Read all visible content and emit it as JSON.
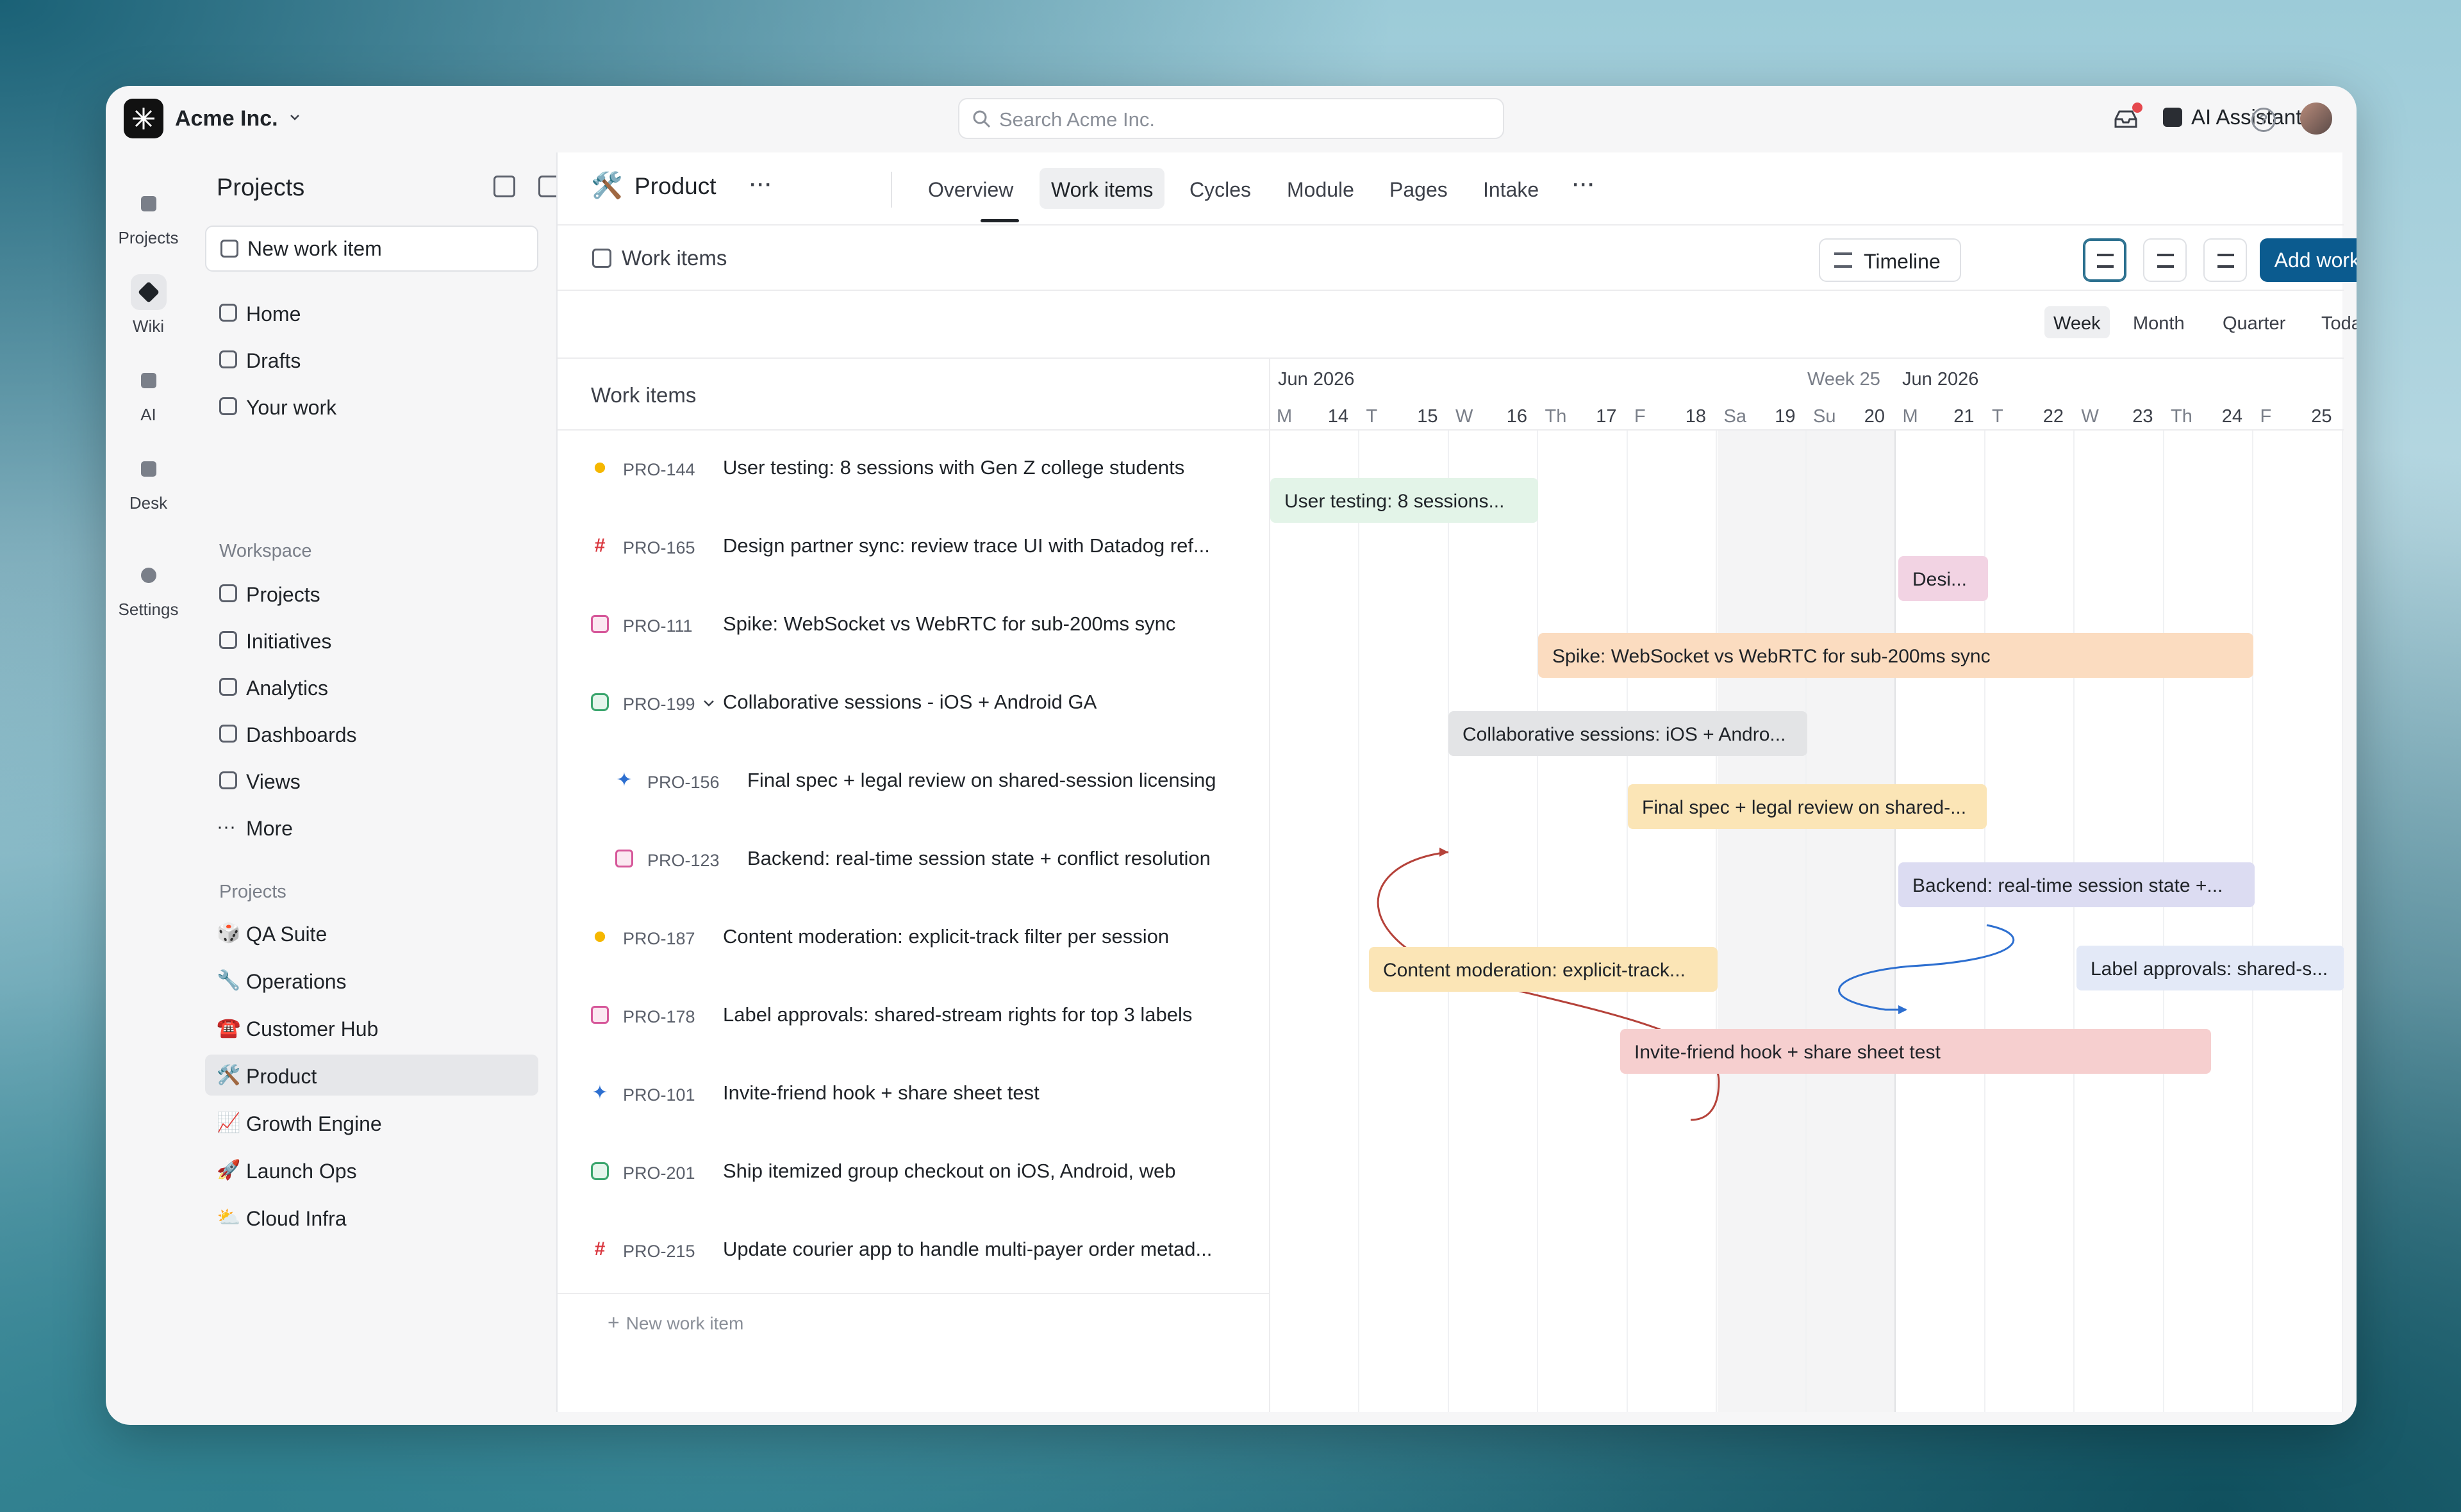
{
  "topbar": {
    "org": "Acme Inc.",
    "search_placeholder": "Search Acme Inc.",
    "ai_label": "AI Assistant"
  },
  "rail": [
    {
      "label": "Projects"
    },
    {
      "label": "Wiki"
    },
    {
      "label": "AI"
    },
    {
      "label": "Desk"
    },
    {
      "label": "Settings"
    }
  ],
  "sidebar": {
    "title": "Projects",
    "new_item": "New work item",
    "main": [
      "Home",
      "Drafts",
      "Your work"
    ],
    "workspace_label": "Workspace",
    "workspace": [
      "Projects",
      "Initiatives",
      "Analytics",
      "Dashboards",
      "Views",
      "More"
    ],
    "projects_label": "Projects",
    "projects": [
      {
        "emoji": "🎲",
        "label": "QA Suite"
      },
      {
        "emoji": "🔧",
        "label": "Operations"
      },
      {
        "emoji": "☎️",
        "label": "Customer Hub"
      },
      {
        "emoji": "🛠️",
        "label": "Product"
      },
      {
        "emoji": "📈",
        "label": "Growth Engine"
      },
      {
        "emoji": "🚀",
        "label": "Launch Ops"
      },
      {
        "emoji": "⛅",
        "label": "Cloud Infra"
      }
    ]
  },
  "header": {
    "project_emoji": "🛠️",
    "project": "Product",
    "more": "···",
    "tabs": [
      "Overview",
      "Work items",
      "Cycles",
      "Module",
      "Pages",
      "Intake"
    ],
    "active_tab": "Work items"
  },
  "toolbar": {
    "title": "Work items",
    "timeline": "Timeline",
    "add": "Add work item"
  },
  "zoom": {
    "options": [
      "Week",
      "Month",
      "Quarter",
      "Today"
    ],
    "selected": "Week"
  },
  "list": {
    "header": "Work items",
    "new_row": "New work item",
    "rows": [
      {
        "icon": "sun",
        "id": "PRO-144",
        "title": "User testing: 8 sessions with Gen Z college students",
        "indent": 0
      },
      {
        "icon": "hash",
        "id": "PRO-165",
        "title": "Design partner sync: review trace UI with Datadog ref...",
        "indent": 0
      },
      {
        "icon": "flag",
        "id": "PRO-111",
        "title": "Spike: WebSocket vs WebRTC for sub-200ms sync",
        "indent": 0
      },
      {
        "icon": "cube",
        "id": "PRO-199",
        "title": "Collaborative sessions - iOS + Android GA",
        "indent": 0,
        "expanded": true
      },
      {
        "icon": "spark",
        "id": "PRO-156",
        "title": "Final spec + legal review on shared-session licensing",
        "indent": 1
      },
      {
        "icon": "flag",
        "id": "PRO-123",
        "title": "Backend: real-time session state + conflict resolution",
        "indent": 1
      },
      {
        "icon": "sun",
        "id": "PRO-187",
        "title": "Content moderation: explicit-track filter per session",
        "indent": 0
      },
      {
        "icon": "flag",
        "id": "PRO-178",
        "title": "Label approvals: shared-stream rights for top 3 labels",
        "indent": 0
      },
      {
        "icon": "spark",
        "id": "PRO-101",
        "title": "Invite-friend hook + share sheet test",
        "indent": 0
      },
      {
        "icon": "cube",
        "id": "PRO-201",
        "title": "Ship itemized group checkout on iOS, Android, web",
        "indent": 0
      },
      {
        "icon": "hash",
        "id": "PRO-215",
        "title": "Update courier app to handle multi-payer order metad...",
        "indent": 0
      }
    ]
  },
  "gantt": {
    "month_left": "Jun 2026",
    "week_label": "Week 25",
    "month_right": "Jun  2026",
    "days": [
      {
        "w": "M",
        "n": "14"
      },
      {
        "w": "T",
        "n": "15"
      },
      {
        "w": "W",
        "n": "16"
      },
      {
        "w": "Th",
        "n": "17"
      },
      {
        "w": "F",
        "n": "18"
      },
      {
        "w": "Sa",
        "n": "19"
      },
      {
        "w": "Su",
        "n": "20"
      },
      {
        "w": "M",
        "n": "21"
      },
      {
        "w": "T",
        "n": "22"
      },
      {
        "w": "W",
        "n": "23"
      },
      {
        "w": "Th",
        "n": "24"
      },
      {
        "w": "F",
        "n": "25"
      }
    ],
    "bars": [
      {
        "label": "User testing: 8 sessions...",
        "color": "#e3f4e8"
      },
      {
        "label": "Desi...",
        "color": "#f2d3e3"
      },
      {
        "label": "Spike: WebSocket vs WebRTC for sub-200ms sync",
        "color": "#fbdcc0"
      },
      {
        "label": "Collaborative sessions: iOS + Andro...",
        "color": "#e3e4e6"
      },
      {
        "label": "Final spec + legal review on shared-...",
        "color": "#fbe5b6"
      },
      {
        "label": "Backend: real-time session state +...",
        "color": "#dcdcf2"
      },
      {
        "label": "Content moderation: explicit-track...",
        "color": "#fbe5b6"
      },
      {
        "label": "Label approvals: shared-s...",
        "color": "#e3e9f7"
      },
      {
        "label": "Invite-friend hook + share sheet test",
        "color": "#f6cfcf"
      }
    ]
  }
}
